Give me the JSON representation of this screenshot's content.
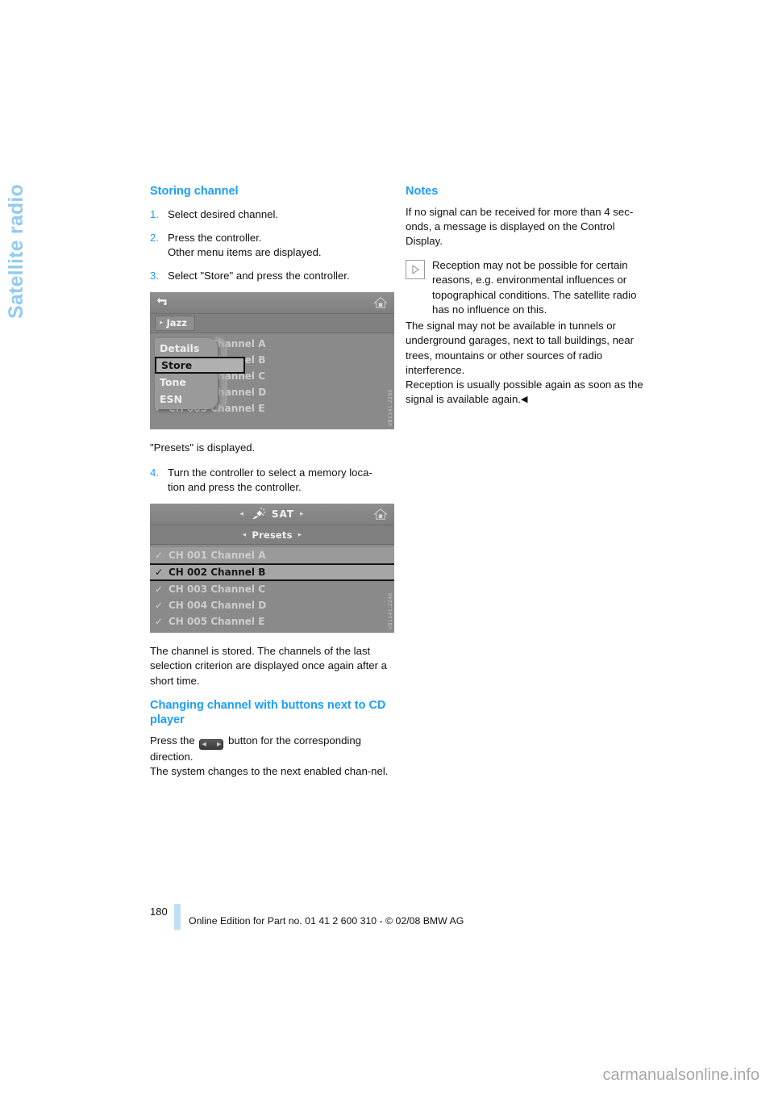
{
  "chapter": {
    "label": "Satellite radio"
  },
  "left_column": {
    "heading": "Storing channel",
    "steps": [
      {
        "num": "1.",
        "text": "Select desired channel."
      },
      {
        "num": "2.",
        "text": "Press the controller.\nOther menu items are displayed."
      },
      {
        "num": "3.",
        "text": "Select \"Store\" and press the controller."
      }
    ],
    "screenshot_menu": {
      "back_icon": "back-arrow-icon",
      "home_icon": "home-icon",
      "tab_label": "Jazz",
      "rows": [
        {
          "check": "✓",
          "label": "CH 001 Channel A"
        },
        {
          "check": "✓",
          "label": "CH 002 Channel B"
        },
        {
          "check": "✓",
          "label": "CH 003 Channel C"
        },
        {
          "check": "✓",
          "label": "CH 004 Channel D"
        },
        {
          "check": "✓",
          "label": "CH 005 Channel E"
        }
      ],
      "popup_items": [
        {
          "label": "Details",
          "selected": false
        },
        {
          "label": "Store",
          "selected": true
        },
        {
          "label": "Tone",
          "selected": false
        },
        {
          "label": "ESN",
          "selected": false
        }
      ],
      "reference_code": "VB1141.2280"
    },
    "after_menu_text": "\"Presets\" is displayed.",
    "step4": {
      "num": "4.",
      "text": "Turn the controller to select a memory loca-\ntion and press the controller."
    },
    "screenshot_presets": {
      "sat_icon": "satellite-icon",
      "home_icon": "home-icon",
      "title": "SAT",
      "presets_label": "Presets",
      "rows": [
        {
          "check": "✓",
          "label": "CH 001 Channel A",
          "selected": false
        },
        {
          "check": "✓",
          "label": "CH 002 Channel B",
          "selected": true
        },
        {
          "check": "✓",
          "label": "CH 003 Channel C",
          "selected": false
        },
        {
          "check": "✓",
          "label": "CH 004 Channel D",
          "selected": false
        },
        {
          "check": "✓",
          "label": "CH 005 Channel E",
          "selected": false
        }
      ],
      "reference_code": "VB1141.2240"
    },
    "stored_text": "The channel is stored. The channels of the last selection criterion are displayed once again after a short time.",
    "heading2": "Changing channel with buttons next to CD player",
    "press_prefix": "Press the",
    "press_suffix": "button for the corresponding direction.",
    "next_channel_text": "The system changes to the next enabled chan-nel."
  },
  "right_column": {
    "heading": "Notes",
    "intro": "If no signal can be received for more than 4 sec-onds, a message is displayed on the Control Display.",
    "note_icon": "play-triangle-icon",
    "note_text": "Reception may not be possible for certain reasons, e.g. environmental influences or topographical conditions. The satellite radio has no influence on this.",
    "note_text2": "The signal may not be available in tunnels or underground garages, next to tall buildings, near trees, mountains or other sources of radio interference.",
    "note_text3": "Reception is usually possible again as soon as the signal is available again.",
    "end_mark": "◀"
  },
  "footer": {
    "page_number": "180",
    "imprint": "Online Edition for Part no. 01 41 2 600 310 - © 02/08 BMW AG"
  },
  "watermark": {
    "text": "carmanualsonline.info"
  },
  "colors": {
    "heading_blue": "#1b9dfa",
    "chapter_blue": "#93cbf0",
    "footer_rule": "#bfdff5",
    "screen_gray": "#8a8a8a"
  }
}
